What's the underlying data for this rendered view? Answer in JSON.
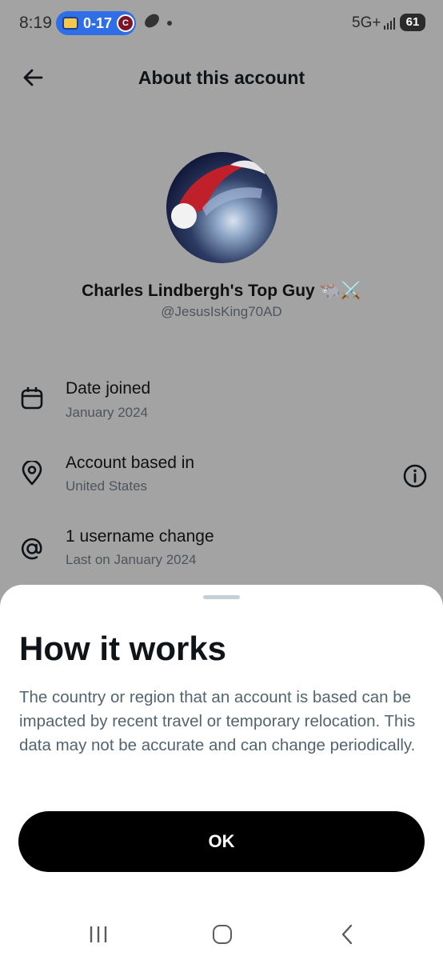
{
  "status_bar": {
    "time": "8:19",
    "score": "0-17",
    "team_b_initial": "C",
    "network": "5G+",
    "battery": "61"
  },
  "header": {
    "title": "About this account",
    "back_icon": "arrow-left-icon"
  },
  "profile": {
    "display_name": "Charles Lindbergh's Top Guy 🐃⚔️",
    "handle": "@JesusIsKing70AD"
  },
  "info_rows": [
    {
      "icon": "calendar-icon",
      "title": "Date joined",
      "subtitle": "January 2024"
    },
    {
      "icon": "location-pin-icon",
      "title": "Account based in",
      "subtitle": "United States"
    },
    {
      "icon": "at-sign-icon",
      "title": "1 username change",
      "subtitle": "Last on January 2024"
    }
  ],
  "sheet": {
    "title": "How it works",
    "body": "The country or region that an account is based can be impacted by recent travel or temporary relocation. This data may not be accurate and can change periodically.",
    "ok_label": "OK"
  },
  "colors": {
    "accent_pill": "#2f6ee6",
    "button_bg": "#000000",
    "secondary_text": "#536471",
    "dim_overlay": "#a3a3a3"
  }
}
